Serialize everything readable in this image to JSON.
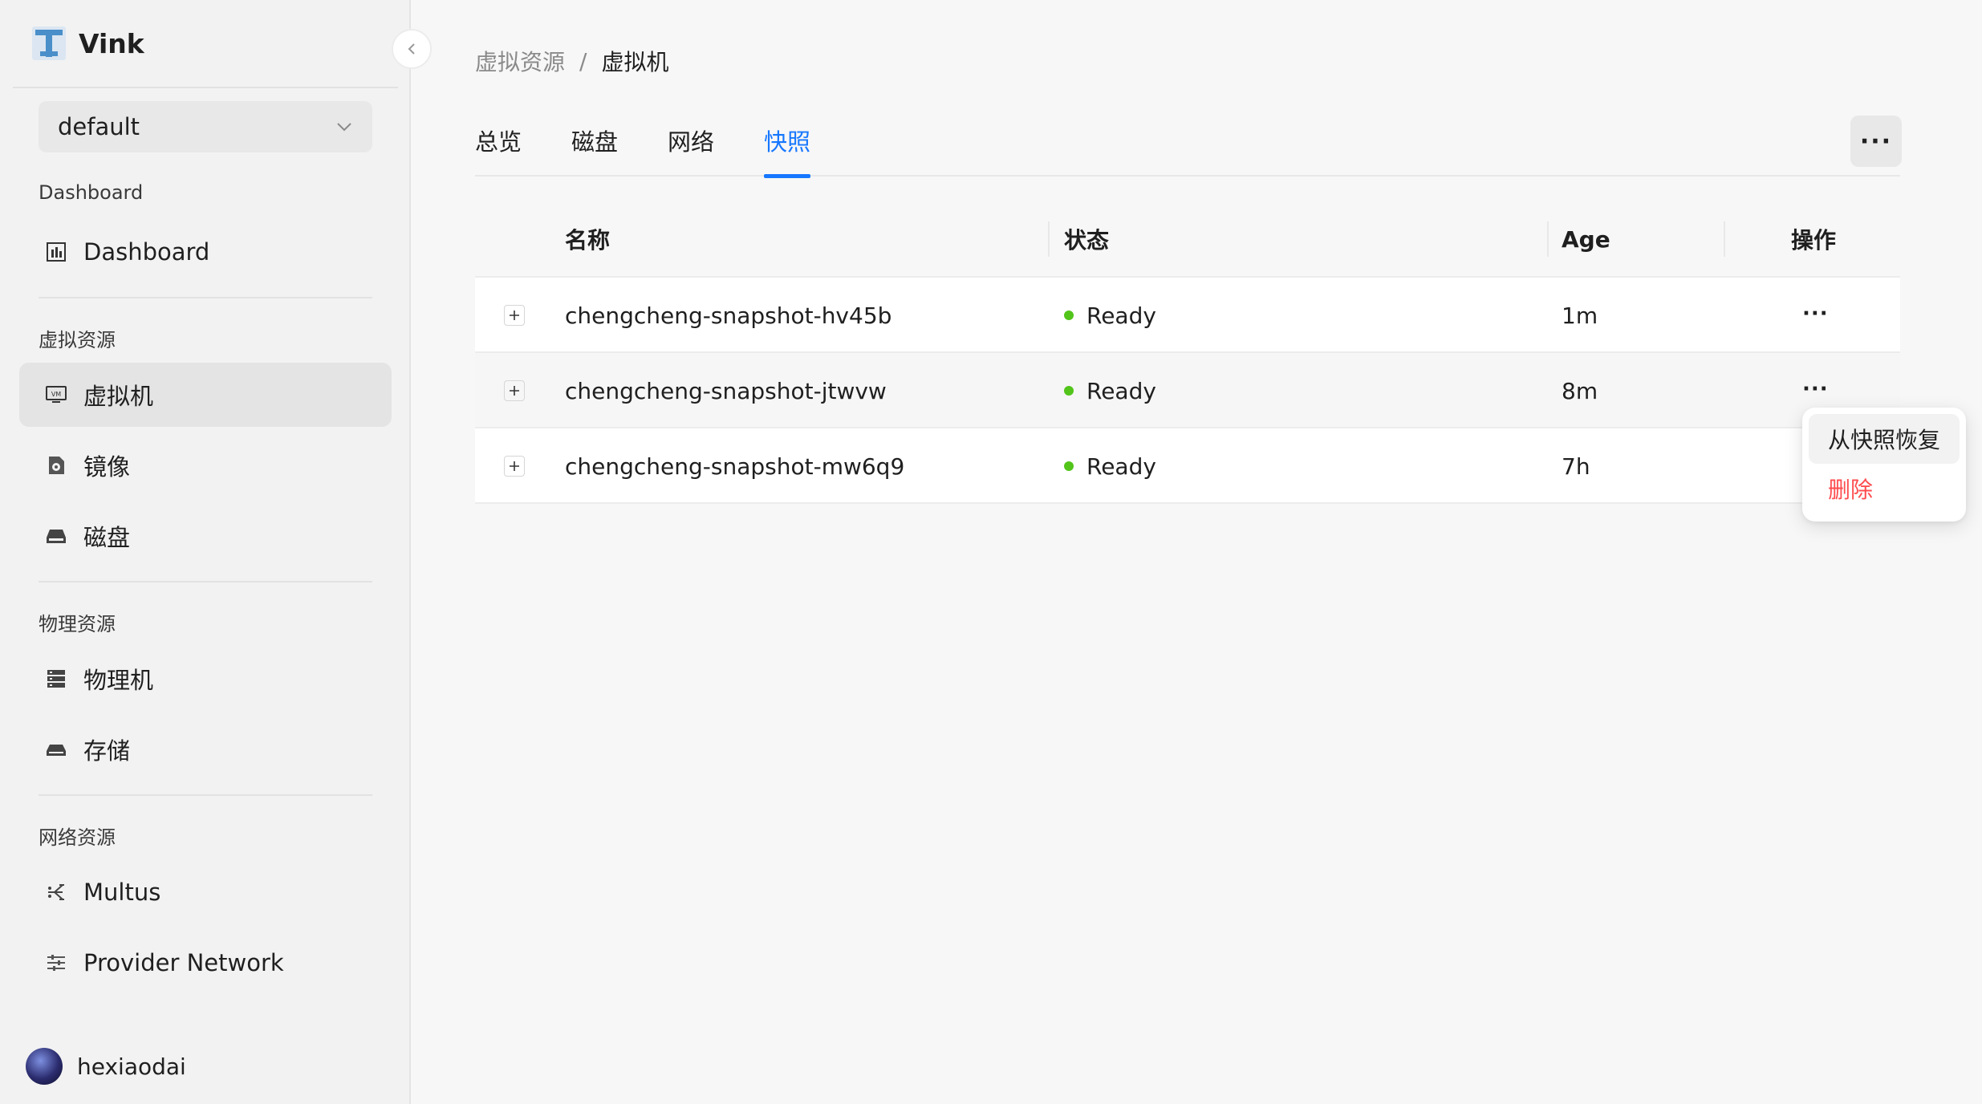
{
  "app": {
    "name": "Vink"
  },
  "sidebar": {
    "namespace": "default",
    "sections": {
      "dashboard": "Dashboard",
      "virtual": "虚拟资源",
      "physical": "物理资源",
      "network": "网络资源"
    },
    "items": {
      "dashboard": "Dashboard",
      "vm": "虚拟机",
      "image": "镜像",
      "disk": "磁盘",
      "host": "物理机",
      "storage": "存储",
      "multus": "Multus",
      "provider_network": "Provider Network"
    },
    "user": "hexiaodai"
  },
  "breadcrumb": {
    "parent": "虚拟资源",
    "separator": "/",
    "current": "虚拟机"
  },
  "tabs": [
    "总览",
    "磁盘",
    "网络",
    "快照"
  ],
  "active_tab": "快照",
  "more_label": "···",
  "table": {
    "columns": {
      "name": "名称",
      "status": "状态",
      "age": "Age",
      "actions": "操作"
    },
    "rows": [
      {
        "name": "chengcheng-snapshot-hv45b",
        "status": "Ready",
        "age": "1m",
        "action": "···"
      },
      {
        "name": "chengcheng-snapshot-jtwvw",
        "status": "Ready",
        "age": "8m",
        "action": "···"
      },
      {
        "name": "chengcheng-snapshot-mw6q9",
        "status": "Ready",
        "age": "7h",
        "action": "···"
      }
    ]
  },
  "dropdown": {
    "restore": "从快照恢复",
    "delete": "删除"
  },
  "colors": {
    "accent": "#1677ff",
    "ready": "#52c41a",
    "danger": "#ff4d4f"
  }
}
